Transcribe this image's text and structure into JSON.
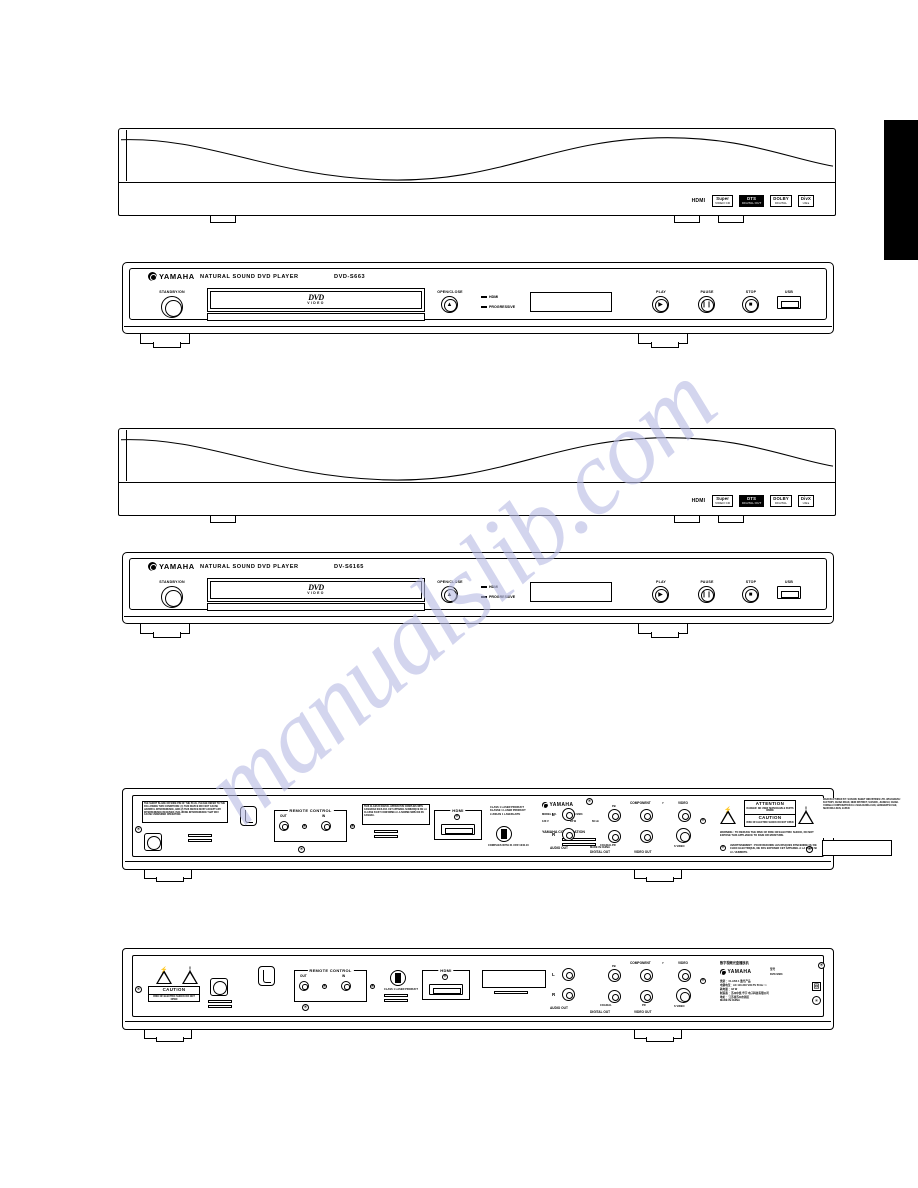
{
  "page": {
    "watermark": "manualslib.com"
  },
  "figures": {
    "top_view_1": {
      "name": "top-view-dvd-s663",
      "badges": [
        {
          "main": "HDMI",
          "sub": ""
        },
        {
          "main": "Super",
          "sub": "VIDEO CD"
        },
        {
          "main": "DTS",
          "sub": "DIGITAL OUT"
        },
        {
          "main": "DOLBY",
          "sub": "DIGITAL"
        },
        {
          "main": "DivX",
          "sub": "Ultra"
        }
      ]
    },
    "front_panel_1": {
      "brand": "YAMAHA",
      "title": "NATURAL SOUND DVD PLAYER",
      "model": "DVD-S663",
      "power_label": "STANDBY/ON",
      "tray_logo_main": "DVD",
      "tray_logo_sub": "VIDEO",
      "open_close_label": "OPEN/CLOSE",
      "open_close_glyph": "▲",
      "indicators": [
        {
          "label": "HDMI"
        },
        {
          "label": "PROGRESSIVE"
        }
      ],
      "buttons": [
        {
          "label": "PLAY",
          "glyph": "▶"
        },
        {
          "label": "PAUSE",
          "glyph": "❙❙"
        },
        {
          "label": "STOP",
          "glyph": "■"
        }
      ],
      "usb_label": "USB"
    },
    "top_view_2": {
      "name": "top-view-dv-s6165",
      "badges": [
        {
          "main": "HDMI",
          "sub": ""
        },
        {
          "main": "Super",
          "sub": "VIDEO CD"
        },
        {
          "main": "DTS",
          "sub": "DIGITAL OUT"
        },
        {
          "main": "DOLBY",
          "sub": "DIGITAL"
        },
        {
          "main": "DivX",
          "sub": "Ultra"
        }
      ]
    },
    "front_panel_2": {
      "brand": "YAMAHA",
      "title": "NATURAL SOUND DVD PLAYER",
      "model": "DV-S6165",
      "power_label": "STANDBY/ON",
      "tray_logo_main": "DVD",
      "tray_logo_sub": "VIDEO",
      "open_close_label": "OPEN/CLOSE",
      "open_close_glyph": "▲",
      "indicators": [
        {
          "label": "HDMI"
        },
        {
          "label": "PROGRESSIVE"
        }
      ],
      "buttons": [
        {
          "label": "PLAY",
          "glyph": "▶"
        },
        {
          "label": "PAUSE",
          "glyph": "❙❙"
        },
        {
          "label": "STOP",
          "glyph": "■"
        }
      ],
      "usb_label": "USB"
    },
    "rear_panel_1": {
      "name": "rear-panel-dvd-s663",
      "safety_text_left": "THE SHORT BLADE OR WIDE PIN OF THE PLUG. PLEASE REFER TO THE FOLLOWING TWO CONDITIONS: (1) THIS DEVICE MAY NOT CAUSE HARMFUL INTERFERENCE, AND (2) THIS DEVICE MUST ACCEPT ANY INTERFERENCE RECEIVED, INCLUDING INTERFERENCE THAT MAY CAUSE UNDESIRED OPERATION.",
      "safety_text_mid": "THIS CLASS B DIGITAL APPARATUS COMPLIES WITH CANADIAN ICES-003. CET APPAREIL NUMERIQUE DE LA CLASSE B EST CONFORME A LA NORME NMB-003 DU CANADA.",
      "remote_control_group": "REMOTE CONTROL",
      "remote_out": "OUT",
      "remote_in": "IN",
      "hdmi_label": "HDMI",
      "laser_label": "CLASS 1 LASER PRODUCT KLASSE 1 LASER PRODUKT LUOKAN 1 LASERLAITE",
      "complies_label": "COMPLIES WITH 21 CFR 1040.10",
      "model_no_label": "MODEL NO.",
      "model_no_value": "DVD-S663",
      "voltage": "120 V",
      "power": "18 W",
      "frequency": "60 Hz",
      "corporation": "YAMAHA CORPORATION",
      "made_in": "MADE IN CHINA",
      "audio_out_label": "AUDIO OUT",
      "digital_out_label": "DIGITAL OUT",
      "coaxial_label": "COAXIAL",
      "video_out_label": "VIDEO OUT",
      "component_label": "COMPONENT",
      "component_pb": "PB",
      "component_y": "Y",
      "component_pr": "PR",
      "video_label": "VIDEO",
      "svideo_label": "S VIDEO",
      "channel_l": "L",
      "channel_r": "R",
      "attention_title": "ATTENTION",
      "attention_body": "DANGER: NO USER SERVICEABLE PARTS INSIDE",
      "caution_title": "CAUTION",
      "caution_body": "RISK OF ELECTRIC SHOCK DO NOT OPEN",
      "warning_text": "WARNING : TO REDUCE THE RISK OF FIRE OR ELECTRIC SHOCK, DO NOT EXPOSE THIS APPLIANCE TO RAIN OR MOISTURE.",
      "avis_text": "AVERTISSEMENT : POUR REDUIRE LES RISQUES D'INCENDIE OU DE CHOC ELECTRIQUE, NE PAS EXPOSER CET APPAREIL A LA PLUIE NI A L'HUMIDITE.",
      "manufacturer_block": "MANUFACTURED BY: SUZHOU SHEET INDUSTRIES LTD. WUJIANGSU FACTORY, CHINA ROAD, NEW DISTRICT, SUZHOU, JIANGSU, CHINA. YAMAHA CORPORATION 10-1 NAKAZAWA-CHO, HAMAMATSU-SHI, SHIZUOKA-KEN, JAPAN"
    },
    "rear_panel_2": {
      "name": "rear-panel-dvd-s663-china",
      "caution_title": "CAUTION",
      "caution_body": "RISK OF ELECTRIC SHOCK DO NOT OPEN",
      "remote_control_group": "REMOTE CONTROL",
      "remote_out": "OUT",
      "remote_in": "IN",
      "hdmi_label": "HDMI",
      "laser_label": "CLASS 1 LASER PRODUCT",
      "audio_out_label": "AUDIO OUT",
      "digital_out_label": "DIGITAL OUT",
      "coaxial_label": "COAXIAL",
      "video_out_label": "VIDEO OUT",
      "component_label": "COMPONENT",
      "component_pb": "PB",
      "component_y": "Y",
      "component_pr": "PR",
      "video_label": "VIDEO",
      "svideo_label": "S VIDEO",
      "channel_l": "L",
      "channel_r": "R",
      "cn_heading": "数字视频光盘播放机",
      "brand_small": "YAMAHA",
      "model_cn_label": "型号",
      "model_cn_value": "DVD-S663",
      "ratings_cn": "类别    ：CLASS 1 激光产品\n电源电压：AC 110-240 VOLTS  50 Hz ～\n耗电量  ：18 W\n制造商  ：苏州中凯 华宇 电子科技有限公司\n地址    ：江苏省苏州市新区\nMADE IN CHINA",
      "made_in": "MADE IN CHINA"
    }
  }
}
